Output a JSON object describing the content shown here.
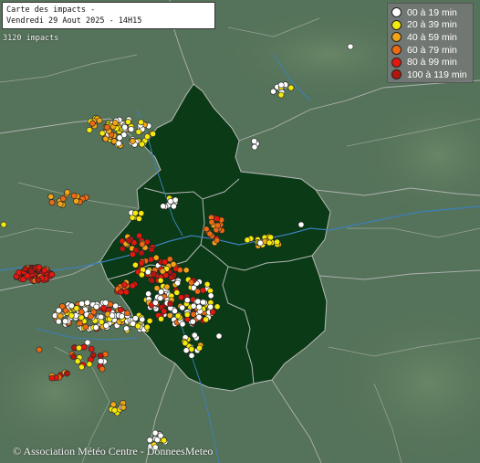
{
  "map": {
    "title_line1": "Carte des impacts -",
    "title_line2": "Vendredi 29 Aout 2025 - 14H15",
    "impact_count": "3120 impacts",
    "credit": "© Association Météo Centre - DonneesMeteo"
  },
  "legend": [
    {
      "label": "00 à 19 min",
      "color": "#ffffff"
    },
    {
      "label": "20 à 39 min",
      "color": "#f5e80c"
    },
    {
      "label": "40 à 59 min",
      "color": "#f2a516"
    },
    {
      "label": "60 à 79 min",
      "color": "#ed6a12"
    },
    {
      "label": "80 à 99 min",
      "color": "#e3180f"
    },
    {
      "label": "100 à 119 min",
      "color": "#b3160f"
    }
  ],
  "colors": {
    "terrain": "#55735a",
    "region_fill": "#0a3a16",
    "borders": "#b8b8b8",
    "rivers": "#3d7fb8"
  }
}
